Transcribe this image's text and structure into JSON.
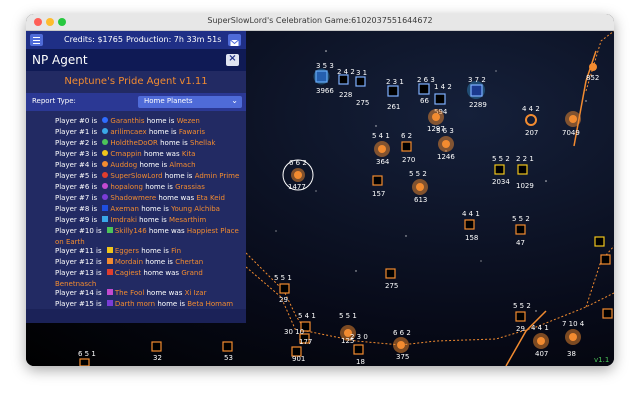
{
  "window": {
    "title": "SuperSlowLord's Celebration Game:6102037551644672"
  },
  "topbar": {
    "credits": "Credits: $1765",
    "production": "Production: 7h 33m 51s"
  },
  "panel": {
    "title": "NP Agent",
    "agent_title": "Neptune's Pride Agent v1.11",
    "report_label": "Report Type:",
    "report_value": "Home Planets"
  },
  "players": [
    {
      "prefix": "Player #0 is",
      "name": "Garanthis",
      "verb": "home is",
      "star": "Wezen",
      "color": "#2f6cff",
      "shape": "circle"
    },
    {
      "prefix": "Player #1 is",
      "name": "arilimcaex",
      "verb": "home is",
      "star": "Fawaris",
      "color": "#3aa7e8",
      "shape": "circle"
    },
    {
      "prefix": "Player #2 is",
      "name": "HoldtheDoOR",
      "verb": "home is",
      "star": "Shellak",
      "color": "#4cc35a",
      "shape": "circle"
    },
    {
      "prefix": "Player #3 is",
      "name": "Cmappin",
      "verb": "home was",
      "star": "Kita",
      "color": "#f0c51c",
      "shape": "circle"
    },
    {
      "prefix": "Player #4 is",
      "name": "Auddog",
      "verb": "home is",
      "star": "Almach",
      "color": "#f28b30",
      "shape": "circle"
    },
    {
      "prefix": "Player #5 is",
      "name": "SuperSlowLord",
      "verb": "home is",
      "star": "Admin Prime",
      "color": "#e03d2d",
      "shape": "circle"
    },
    {
      "prefix": "Player #6 is",
      "name": "hopalong",
      "verb": "home is",
      "star": "Grassias",
      "color": "#c34ad0",
      "shape": "circle"
    },
    {
      "prefix": "Player #7 is",
      "name": "Shadowmere",
      "verb": "home was",
      "star": "Eta Keid",
      "color": "#7a3cd6",
      "shape": "circle"
    },
    {
      "prefix": "Player #8 is",
      "name": "Axeman",
      "verb": "home is",
      "star": "Young Alchiba",
      "color": "#1f4fe0",
      "shape": "square"
    },
    {
      "prefix": "Player #9 is",
      "name": "Imdraki",
      "verb": "home is",
      "star": "Mesarthim",
      "color": "#3aa7e8",
      "shape": "square"
    },
    {
      "prefix": "Player #10 is",
      "name": "Skilly146",
      "verb": "home was",
      "star": "Happiest Place on Earth",
      "color": "#4cc35a",
      "shape": "square"
    },
    {
      "prefix": "Player #11 is",
      "name": "Eggers",
      "verb": "home is",
      "star": "Fin",
      "color": "#f0c51c",
      "shape": "square"
    },
    {
      "prefix": "Player #12 is",
      "name": "Mordain",
      "verb": "home is",
      "star": "Chertan",
      "color": "#f28b30",
      "shape": "square"
    },
    {
      "prefix": "Player #13 is",
      "name": "Cagiest",
      "verb": "home was",
      "star": "Grand Benetnasch",
      "color": "#e03d2d",
      "shape": "square"
    },
    {
      "prefix": "Player #14 is",
      "name": "The Fool",
      "verb": "home was",
      "star": "Xi Izar",
      "color": "#c34ad0",
      "shape": "square"
    },
    {
      "prefix": "Player #15 is",
      "name": "Darth morn",
      "verb": "home is",
      "star": "Beta Homam",
      "color": "#7a3cd6",
      "shape": "square"
    }
  ],
  "map": {
    "stars": [
      {
        "top": "3 5 3",
        "bottom": "3966",
        "kind": "blue"
      },
      {
        "top": "2 4 2",
        "bottom": "228",
        "kind": "blue"
      },
      {
        "top": "3 1",
        "bottom": "275",
        "kind": "blue"
      },
      {
        "top": "2 3 1",
        "bottom": "261",
        "kind": "blue"
      },
      {
        "top": "2 6 3",
        "bottom": "66",
        "kind": "blue"
      },
      {
        "top": "1 4 2",
        "bottom": "594",
        "kind": "blue"
      },
      {
        "top": "3 7 2",
        "bottom": "2289",
        "kind": "blue"
      },
      {
        "top": "",
        "bottom": "1297",
        "kind": "orange"
      },
      {
        "top": "4 4 2",
        "bottom": "207",
        "kind": "orange-ring"
      },
      {
        "top": "",
        "bottom": "7049",
        "kind": "orange"
      },
      {
        "top": "",
        "bottom": "852",
        "kind": "orange"
      },
      {
        "top": "5 4 1",
        "bottom": "364",
        "kind": "orange"
      },
      {
        "top": "6 2",
        "bottom": "270",
        "kind": "orange"
      },
      {
        "top": "5 6 3",
        "bottom": "1246",
        "kind": "orange"
      },
      {
        "top": "5 5 2",
        "bottom": "2034",
        "kind": "yellow"
      },
      {
        "top": "2 2 1",
        "bottom": "1029",
        "kind": "yellow"
      },
      {
        "top": "6 6 2",
        "bottom": "1477",
        "kind": "selected"
      },
      {
        "top": "",
        "bottom": "157",
        "kind": "orange-box"
      },
      {
        "top": "5 5 2",
        "bottom": "613",
        "kind": "orange"
      },
      {
        "top": "4 4 1",
        "bottom": "158",
        "kind": "orange-box"
      },
      {
        "top": "5 5 2",
        "bottom": "47",
        "kind": "orange-box"
      },
      {
        "top": "",
        "bottom": "275",
        "kind": "orange-box"
      },
      {
        "top": "5 5 1",
        "bottom": "29",
        "kind": "orange-box"
      },
      {
        "top": "5 4 1",
        "bottom": "",
        "kind": "orange-box"
      },
      {
        "top": "30 10",
        "bottom": "177",
        "kind": "orange-box"
      },
      {
        "top": "5 5 1",
        "bottom": "125",
        "kind": "orange"
      },
      {
        "top": "2 3 0",
        "bottom": "18",
        "kind": "orange-box"
      },
      {
        "top": "6 6 2",
        "bottom": "375",
        "kind": "orange"
      },
      {
        "top": "",
        "bottom": "901",
        "kind": "orange-box"
      },
      {
        "top": "5 5 2",
        "bottom": "29",
        "kind": "orange-box"
      },
      {
        "top": "4 4 1",
        "bottom": "407",
        "kind": "orange"
      },
      {
        "top": "7 10 4",
        "bottom": "38",
        "kind": "orange"
      },
      {
        "top": "",
        "bottom": "32",
        "kind": "orange-box"
      },
      {
        "top": "",
        "bottom": "53",
        "kind": "orange-box"
      },
      {
        "top": "6 5 1",
        "bottom": "",
        "kind": "orange-box"
      },
      {
        "top": "",
        "bottom": "v1.11",
        "kind": "text"
      }
    ]
  }
}
